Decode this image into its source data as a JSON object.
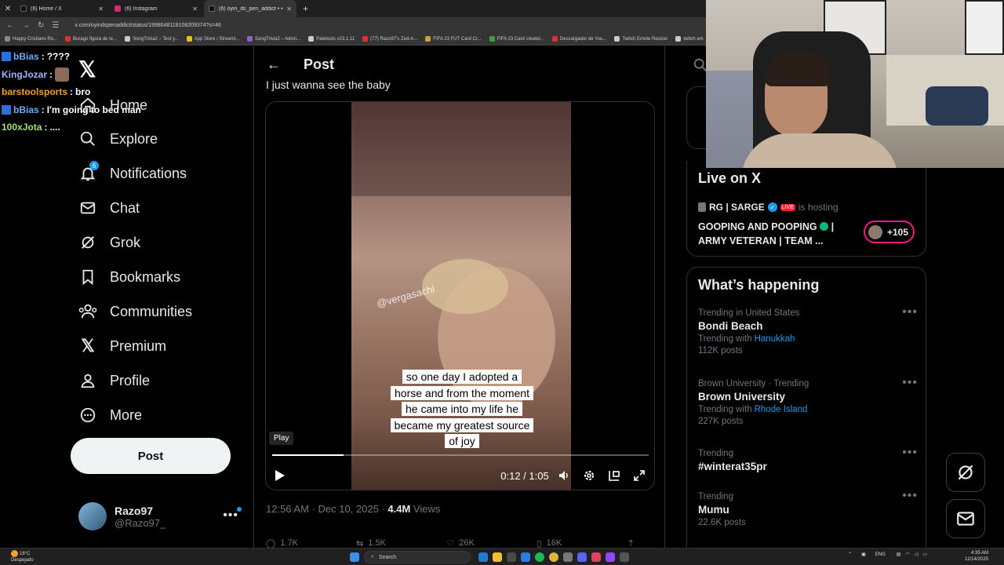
{
  "browser": {
    "tabs": [
      {
        "title": "(6) Home / X",
        "favicon_color": "#111111",
        "active": false
      },
      {
        "title": "(6) Instagram",
        "favicon_color": "#d62976",
        "active": false
      },
      {
        "title": "(6) oyin_ds_pen_addict • • •",
        "favicon_color": "#111111",
        "active": true
      }
    ],
    "url": "x.com/oyindspenaddict/status/1998648118108209374?s=46",
    "bookmarks": [
      {
        "label": "Happy Cristiano Ro...",
        "color": "#888888"
      },
      {
        "label": "Burago figura de te...",
        "color": "#e03030"
      },
      {
        "label": "SongTrivia2 – Test y...",
        "color": "#cccccc"
      },
      {
        "label": "App Store / Streaml...",
        "color": "#f0c020"
      },
      {
        "label": "SongTrivia2 – Advin...",
        "color": "#9060d0"
      },
      {
        "label": "Paletools v23.1.11",
        "color": "#cccccc"
      },
      {
        "label": "(77) Razo97's Zed-A...",
        "color": "#e03030"
      },
      {
        "label": "FIFA 23 FUT Card Cr...",
        "color": "#d0a030"
      },
      {
        "label": "FIFA 23 Card creator...",
        "color": "#40a040"
      },
      {
        "label": "Descargador de You...",
        "color": "#e03030"
      },
      {
        "label": "Twitch Emote Resizer",
        "color": "#cccccc"
      },
      {
        "label": "twitch em",
        "color": "#cccccc"
      }
    ]
  },
  "chat": [
    {
      "user": "bBias",
      "color": "#6ab0f3",
      "badge": true,
      "message": "????"
    },
    {
      "user": "KingJozar",
      "color": "#9db7ff",
      "badge": false,
      "message": ""
    },
    {
      "user": "barstoolsports",
      "color": "#f0a030",
      "badge": false,
      "message": "bro"
    },
    {
      "user": "bBias",
      "color": "#6ab0f3",
      "badge": true,
      "message": "I'm going to bed man"
    },
    {
      "user": "100xJota",
      "color": "#a8e06a",
      "badge": false,
      "message": "...."
    }
  ],
  "sidebar": {
    "items": [
      {
        "label": "Home",
        "icon": "home-icon"
      },
      {
        "label": "Explore",
        "icon": "search-icon"
      },
      {
        "label": "Notifications",
        "icon": "bell-icon",
        "badge": "6"
      },
      {
        "label": "Chat",
        "icon": "mail-icon"
      },
      {
        "label": "Grok",
        "icon": "grok-icon"
      },
      {
        "label": "Bookmarks",
        "icon": "bookmark-icon"
      },
      {
        "label": "Communities",
        "icon": "communities-icon"
      },
      {
        "label": "Premium",
        "icon": "x-logo-icon"
      },
      {
        "label": "Profile",
        "icon": "person-icon"
      },
      {
        "label": "More",
        "icon": "more-circle-icon"
      }
    ],
    "post_label": "Post",
    "profile": {
      "name": "Razo97",
      "handle": "@Razo97_"
    }
  },
  "main": {
    "title": "Post",
    "tweet_text": "I just wanna see the baby",
    "video": {
      "watermark": "@vergasachi",
      "caption_lines": [
        "so one day I adopted a",
        "horse and from the moment",
        "he came into my life he",
        "became my greatest source",
        "of joy"
      ],
      "tooltip": "Play",
      "time": "0:12 / 1:05",
      "progress": 0.19
    },
    "meta": {
      "time": "12:56 AM · Dec 10, 2025 ·",
      "views": "4.4M",
      "views_label": "Views"
    },
    "actions": {
      "replies": "1.7K",
      "reposts": "1.5K",
      "likes": "26K",
      "bookmarks": "16K"
    }
  },
  "live": {
    "title": "Live on X",
    "host": "RG | SARGE",
    "live_tag": "LIVE",
    "hosting_text": "is hosting",
    "stream_title_1": "GOOPING AND POOPING",
    "stream_title_2": "| ARMY VETERAN | TEAM ...",
    "listeners": "+105"
  },
  "trends": {
    "title": "What’s happening",
    "items": [
      {
        "context": "Trending in United States",
        "name": "Bondi Beach",
        "with_label": "Trending with",
        "with": "Hanukkah",
        "count": "112K posts"
      },
      {
        "context": "Brown University · Trending",
        "name": "Brown University",
        "with_label": "Trending with",
        "with": "Rhode Island",
        "count": "227K posts"
      },
      {
        "context": "Trending",
        "name": "#winterat35pr",
        "with_label": "",
        "with": "",
        "count": ""
      },
      {
        "context": "Trending",
        "name": "Mumu",
        "with_label": "",
        "with": "",
        "count": "22.6K posts"
      }
    ]
  },
  "taskbar": {
    "weather_temp": "18°C",
    "weather_desc": "Despejado",
    "search": "Search",
    "lang": "ENG",
    "time": "4:35 AM",
    "date": "12/14/2025"
  }
}
